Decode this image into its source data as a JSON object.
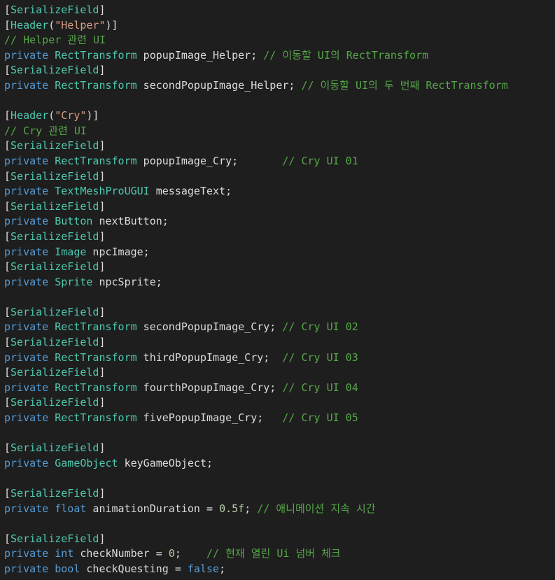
{
  "colors": {
    "background": "#1e1e1e",
    "keyword": "#569cd6",
    "type": "#4ec9b0",
    "string": "#d69d85",
    "comment": "#57a64a",
    "number": "#b5cea8",
    "plain": "#dcdcdc"
  },
  "lines": [
    [
      [
        "pl",
        "["
      ],
      [
        "ty",
        "SerializeField"
      ],
      [
        "pl",
        "]"
      ]
    ],
    [
      [
        "pl",
        "["
      ],
      [
        "ty",
        "Header"
      ],
      [
        "pl",
        "("
      ],
      [
        "st",
        "\"Helper\""
      ],
      [
        "pl",
        ")]"
      ]
    ],
    [
      [
        "cm",
        "// Helper 관련 UI"
      ]
    ],
    [
      [
        "kw",
        "private "
      ],
      [
        "ty",
        "RectTransform"
      ],
      [
        "pl",
        " popupImage_Helper; "
      ],
      [
        "cm",
        "// 이동할 UI의 RectTransform"
      ]
    ],
    [
      [
        "pl",
        "["
      ],
      [
        "ty",
        "SerializeField"
      ],
      [
        "pl",
        "]"
      ]
    ],
    [
      [
        "kw",
        "private "
      ],
      [
        "ty",
        "RectTransform"
      ],
      [
        "pl",
        " secondPopupImage_Helper; "
      ],
      [
        "cm",
        "// 이동할 UI의 두 번째 RectTransform"
      ]
    ],
    [],
    [
      [
        "pl",
        "["
      ],
      [
        "ty",
        "Header"
      ],
      [
        "pl",
        "("
      ],
      [
        "st",
        "\"Cry\""
      ],
      [
        "pl",
        ")]"
      ]
    ],
    [
      [
        "cm",
        "// Cry 관련 UI"
      ]
    ],
    [
      [
        "pl",
        "["
      ],
      [
        "ty",
        "SerializeField"
      ],
      [
        "pl",
        "]"
      ]
    ],
    [
      [
        "kw",
        "private "
      ],
      [
        "ty",
        "RectTransform"
      ],
      [
        "pl",
        " popupImage_Cry;       "
      ],
      [
        "cm",
        "// Cry UI 01"
      ]
    ],
    [
      [
        "pl",
        "["
      ],
      [
        "ty",
        "SerializeField"
      ],
      [
        "pl",
        "]"
      ]
    ],
    [
      [
        "kw",
        "private "
      ],
      [
        "ty",
        "TextMeshProUGUI"
      ],
      [
        "pl",
        " messageText;"
      ]
    ],
    [
      [
        "pl",
        "["
      ],
      [
        "ty",
        "SerializeField"
      ],
      [
        "pl",
        "]"
      ]
    ],
    [
      [
        "kw",
        "private "
      ],
      [
        "ty",
        "Button"
      ],
      [
        "pl",
        " nextButton;"
      ]
    ],
    [
      [
        "pl",
        "["
      ],
      [
        "ty",
        "SerializeField"
      ],
      [
        "pl",
        "]"
      ]
    ],
    [
      [
        "kw",
        "private "
      ],
      [
        "ty",
        "Image"
      ],
      [
        "pl",
        " npcImage;"
      ]
    ],
    [
      [
        "pl",
        "["
      ],
      [
        "ty",
        "SerializeField"
      ],
      [
        "pl",
        "]"
      ]
    ],
    [
      [
        "kw",
        "private "
      ],
      [
        "ty",
        "Sprite"
      ],
      [
        "pl",
        " npcSprite;"
      ]
    ],
    [],
    [
      [
        "pl",
        "["
      ],
      [
        "ty",
        "SerializeField"
      ],
      [
        "pl",
        "]"
      ]
    ],
    [
      [
        "kw",
        "private "
      ],
      [
        "ty",
        "RectTransform"
      ],
      [
        "pl",
        " secondPopupImage_Cry; "
      ],
      [
        "cm",
        "// Cry UI 02"
      ]
    ],
    [
      [
        "pl",
        "["
      ],
      [
        "ty",
        "SerializeField"
      ],
      [
        "pl",
        "]"
      ]
    ],
    [
      [
        "kw",
        "private "
      ],
      [
        "ty",
        "RectTransform"
      ],
      [
        "pl",
        " thirdPopupImage_Cry;  "
      ],
      [
        "cm",
        "// Cry UI 03"
      ]
    ],
    [
      [
        "pl",
        "["
      ],
      [
        "ty",
        "SerializeField"
      ],
      [
        "pl",
        "]"
      ]
    ],
    [
      [
        "kw",
        "private "
      ],
      [
        "ty",
        "RectTransform"
      ],
      [
        "pl",
        " fourthPopupImage_Cry; "
      ],
      [
        "cm",
        "// Cry UI 04"
      ]
    ],
    [
      [
        "pl",
        "["
      ],
      [
        "ty",
        "SerializeField"
      ],
      [
        "pl",
        "]"
      ]
    ],
    [
      [
        "kw",
        "private "
      ],
      [
        "ty",
        "RectTransform"
      ],
      [
        "pl",
        " fivePopupImage_Cry;   "
      ],
      [
        "cm",
        "// Cry UI 05"
      ]
    ],
    [],
    [
      [
        "pl",
        "["
      ],
      [
        "ty",
        "SerializeField"
      ],
      [
        "pl",
        "]"
      ]
    ],
    [
      [
        "kw",
        "private "
      ],
      [
        "ty",
        "GameObject"
      ],
      [
        "pl",
        " keyGameObject;"
      ]
    ],
    [],
    [
      [
        "pl",
        "["
      ],
      [
        "ty",
        "SerializeField"
      ],
      [
        "pl",
        "]"
      ]
    ],
    [
      [
        "kw",
        "private "
      ],
      [
        "kw",
        "float"
      ],
      [
        "pl",
        " animationDuration = "
      ],
      [
        "nu",
        "0.5f"
      ],
      [
        "pl",
        "; "
      ],
      [
        "cm",
        "// 애니메이션 지속 시간"
      ]
    ],
    [],
    [
      [
        "pl",
        "["
      ],
      [
        "ty",
        "SerializeField"
      ],
      [
        "pl",
        "]"
      ]
    ],
    [
      [
        "kw",
        "private "
      ],
      [
        "kw",
        "int"
      ],
      [
        "pl",
        " checkNumber = "
      ],
      [
        "nu",
        "0"
      ],
      [
        "pl",
        ";    "
      ],
      [
        "cm",
        "// 현재 열린 Ui 넘버 체크"
      ]
    ],
    [
      [
        "kw",
        "private "
      ],
      [
        "kw",
        "bool"
      ],
      [
        "pl",
        " checkQuesting = "
      ],
      [
        "kw",
        "false"
      ],
      [
        "pl",
        ";"
      ]
    ]
  ]
}
